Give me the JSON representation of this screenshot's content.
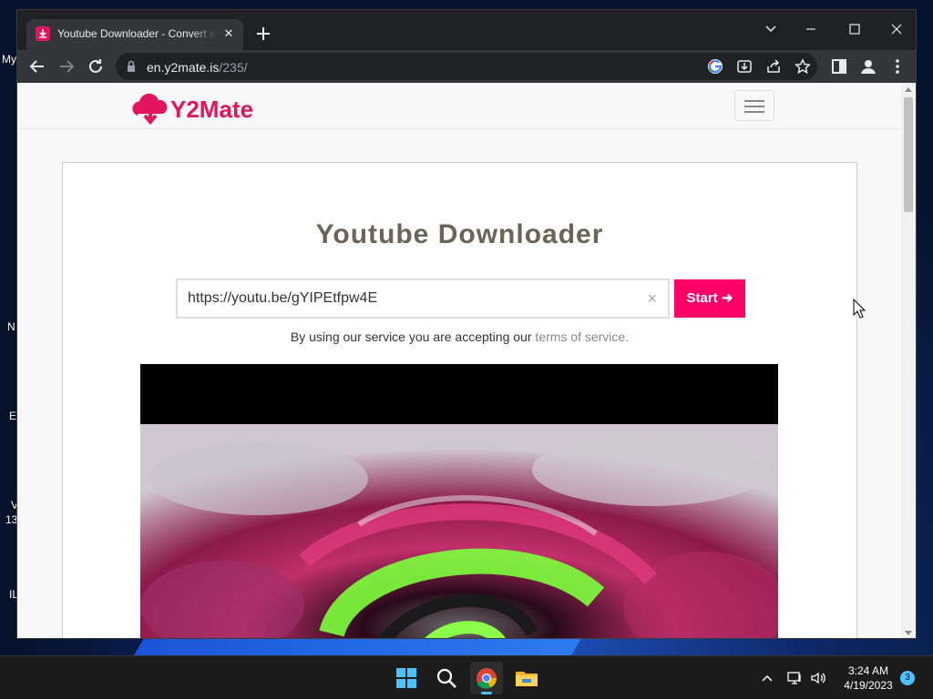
{
  "desktop": {
    "fragments": [
      "My",
      "N",
      "E",
      "V",
      "13",
      "IL"
    ]
  },
  "browser": {
    "tab": {
      "title": "Youtube Downloader - Convert & Download"
    },
    "address": {
      "host": "en.y2mate.is",
      "path": "/235/"
    }
  },
  "site": {
    "logo_text": "Y2Mate",
    "heading": "Youtube Downloader",
    "search": {
      "value": "https://youtu.be/gYIPEtfpw4E",
      "clear_glyph": "×"
    },
    "start_label": "Start ➜",
    "tos_prefix": "By using our service you are accepting our ",
    "tos_link": "terms of service."
  },
  "taskbar": {
    "time": "3:24 AM",
    "date": "4/19/2023",
    "notification_count": "3"
  },
  "colors": {
    "brand": "#e1145c",
    "start_button": "#ff0068"
  }
}
